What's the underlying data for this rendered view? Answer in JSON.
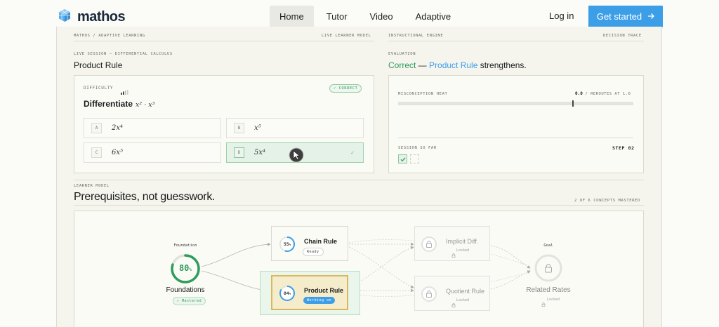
{
  "nav": {
    "brand": "mathos",
    "links": [
      "Home",
      "Tutor",
      "Video",
      "Adaptive"
    ],
    "active": "Home",
    "login": "Log in",
    "cta": "Get started"
  },
  "header": {
    "left": "MATHOS / ADAPTIVE LEARNING",
    "left_right": "LIVE LEARNER MODEL",
    "right": "INSTRUCTIONAL ENGINE",
    "right_right": "DECISION TRACE"
  },
  "session": {
    "label": "LIVE SESSION — DIFFERENTIAL CALCULUS",
    "title": "Product Rule",
    "difficulty_label": "DIFFICULTY",
    "status": "✓ CORRECT",
    "question_prefix": "Differentiate",
    "question_math": "x² · x³",
    "options": [
      {
        "letter": "A",
        "value": "2x⁴"
      },
      {
        "letter": "B",
        "value": "x⁵"
      },
      {
        "letter": "C",
        "value": "6x⁵"
      },
      {
        "letter": "D",
        "value": "5x⁴",
        "selected": true
      }
    ],
    "check_mark": "✓"
  },
  "evaluation": {
    "label": "EVALUATION",
    "correct": "Correct",
    "dash": " — ",
    "concept": "Product Rule",
    "tail": " strengthens.",
    "heat_label": "MISCONCEPTION HEAT",
    "heat_value": "0.0",
    "heat_reroute": "/ REROUTES AT 1.0",
    "heat_level": 0.0,
    "reroute_threshold": 1.0,
    "session_label": "SESSION SO FAR",
    "step": "STEP 02"
  },
  "learner": {
    "label": "LEARNER MODEL",
    "title": "Prerequisites, not guesswork.",
    "mastered": "2 OF 6 CONCEPTS MASTERED"
  },
  "graph": {
    "foundation_caption": "Foundation",
    "foundation_pct": "80",
    "foundation_pct_value": 80,
    "foundation_name": "Foundations",
    "foundation_badge": "✓ Mastered",
    "chain": {
      "name": "Chain Rule",
      "pct": "55",
      "pct_value": 55,
      "badge": "Ready"
    },
    "product": {
      "name": "Product Rule",
      "pct": "84",
      "pct_value": 84,
      "badge": "Working on"
    },
    "implicit": {
      "name": "Implicit Diff.",
      "badge": "Locked"
    },
    "quotient": {
      "name": "Quotient Rule",
      "badge": "Locked"
    },
    "goal_caption": "Goal",
    "goal_name": "Related Rates",
    "goal_badge": "Locked",
    "percent_sign": "%"
  },
  "colors": {
    "accent": "#3d9ee8",
    "green": "#2e9c5c",
    "product_fill": "#f4eccb",
    "product_border": "#d8b85a"
  }
}
